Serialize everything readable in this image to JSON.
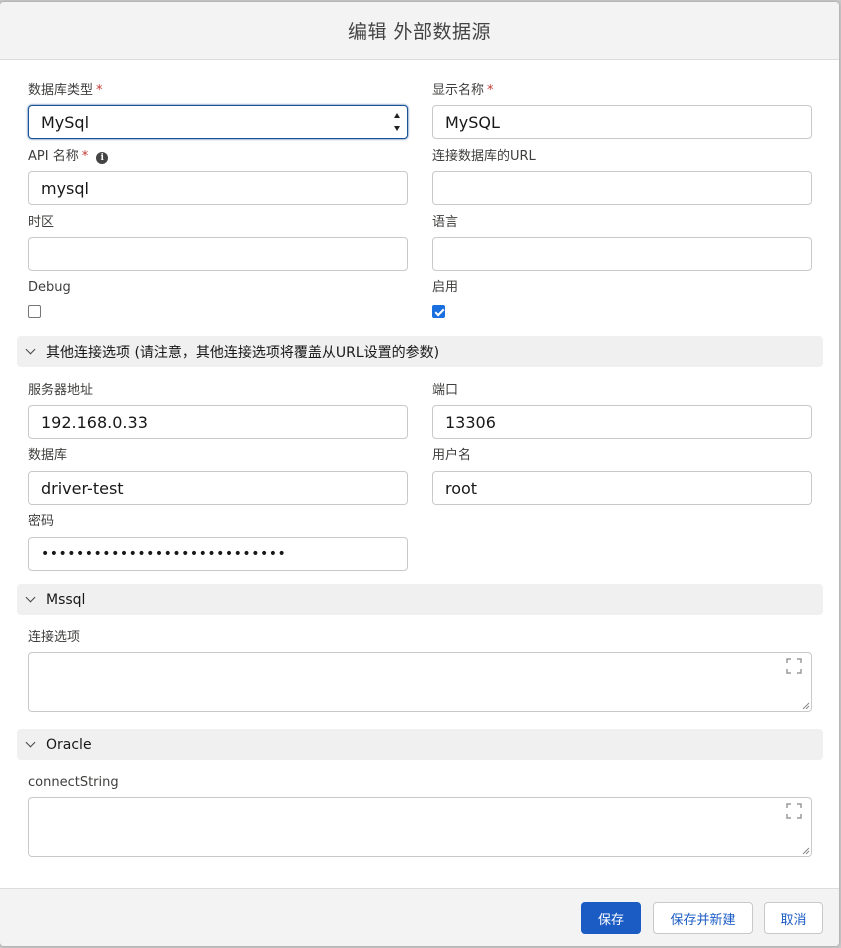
{
  "modal": {
    "title": "编辑 外部数据源"
  },
  "fields": {
    "db_type": {
      "label": "数据库类型",
      "required": "*",
      "value": "MySql"
    },
    "display_name": {
      "label": "显示名称",
      "required": "*",
      "value": "MySQL"
    },
    "api_name": {
      "label": "API 名称",
      "required": "*",
      "info_glyph": "i",
      "value": "mysql"
    },
    "url": {
      "label": "连接数据库的URL",
      "value": ""
    },
    "timezone": {
      "label": "时区",
      "value": ""
    },
    "language": {
      "label": "语言",
      "value": ""
    },
    "debug": {
      "label": "Debug",
      "checked": false
    },
    "enabled": {
      "label": "启用",
      "checked": true
    }
  },
  "sections": {
    "other": {
      "title": "其他连接选项 (请注意，其他连接选项将覆盖从URL设置的参数)",
      "server": {
        "label": "服务器地址",
        "value": "192.168.0.33"
      },
      "port": {
        "label": "端口",
        "value": "13306"
      },
      "database": {
        "label": "数据库",
        "value": "driver-test"
      },
      "username": {
        "label": "用户名",
        "value": "root"
      },
      "password": {
        "label": "密码",
        "value": "••••••••••••••••••••••••••••"
      }
    },
    "mssql": {
      "title": "Mssql",
      "options_label": "连接选项",
      "options_value": ""
    },
    "oracle": {
      "title": "Oracle",
      "connect_label": "connectString",
      "connect_value": ""
    }
  },
  "footer": {
    "save": "保存",
    "save_new": "保存并新建",
    "cancel": "取消"
  },
  "colors": {
    "primary": "#1b5cc4",
    "required": "#c23934",
    "checkbox": "#1a6fe0"
  }
}
